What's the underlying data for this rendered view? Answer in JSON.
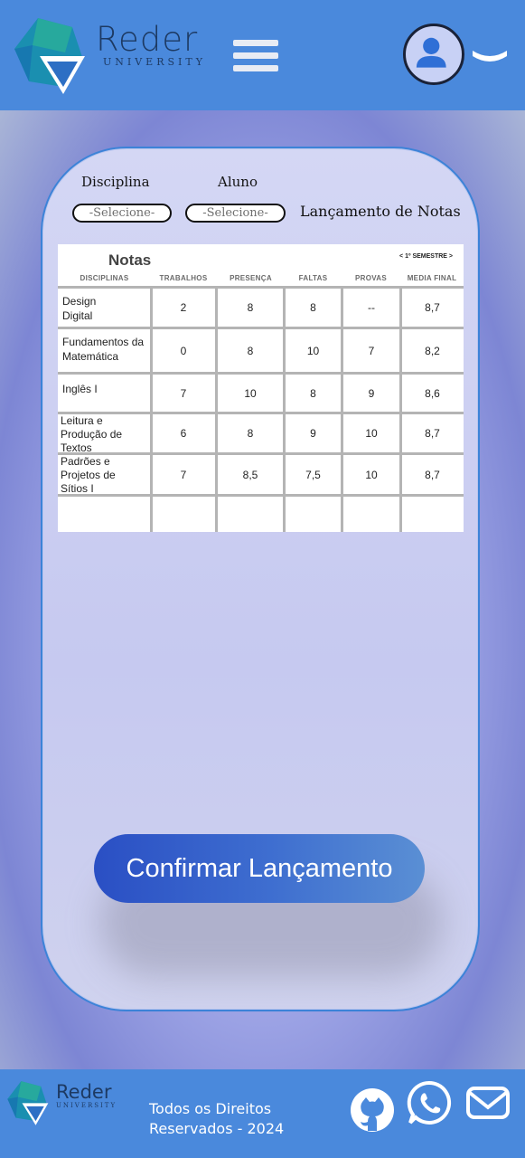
{
  "header": {
    "brand_name": "Reder",
    "brand_sub": "UNIVERSITY"
  },
  "filters": {
    "disciplina_label": "Disciplina",
    "aluno_label": "Aluno",
    "disciplina_select": "-Selecione-",
    "aluno_select": "-Selecione-",
    "page_heading": "Lançamento de Notas"
  },
  "grades": {
    "title": "Notas",
    "semester": "<  1º SEMESTRE  >",
    "columns": [
      "DISCIPLINAS",
      "TRABALHOS",
      "PRESENÇA",
      "FALTAS",
      "PROVAS",
      "MEDIA FINAL"
    ],
    "rows": [
      {
        "subject": "Design\nDigital",
        "trabalhos": "2",
        "presenca": "8",
        "faltas": "8",
        "provas": "--",
        "media": "8,7"
      },
      {
        "subject": "Fundamentos da\nMatemática",
        "trabalhos": "0",
        "presenca": "8",
        "faltas": "10",
        "provas": "7",
        "media": "8,2"
      },
      {
        "subject": "Inglês I",
        "trabalhos": "7",
        "presenca": "10",
        "faltas": "8",
        "provas": "9",
        "media": "8,6"
      },
      {
        "subject": "Leitura e\nProdução de\nTextos",
        "trabalhos": "6",
        "presenca": "8",
        "faltas": "9",
        "provas": "10",
        "media": "8,7"
      },
      {
        "subject": "Padrões e\nProjetos de\nSítios I",
        "trabalhos": "7",
        "presenca": "8,5",
        "faltas": "7,5",
        "provas": "10",
        "media": "8,7"
      }
    ]
  },
  "confirm_label": "Confirmar Lançamento",
  "footer": {
    "brand_name": "Reder",
    "brand_sub": "UNIVERSITY",
    "copyright_line1": "Todos os Direitos",
    "copyright_line2": "Reservados - 2024"
  },
  "colors": {
    "header_bg": "#4a89dc",
    "button_start": "#2a4fc4",
    "button_end": "#5a8fd4"
  },
  "icons": [
    "logo-icon",
    "menu-icon",
    "user-icon",
    "chevron-down-icon",
    "github-icon",
    "whatsapp-icon",
    "mail-icon"
  ]
}
